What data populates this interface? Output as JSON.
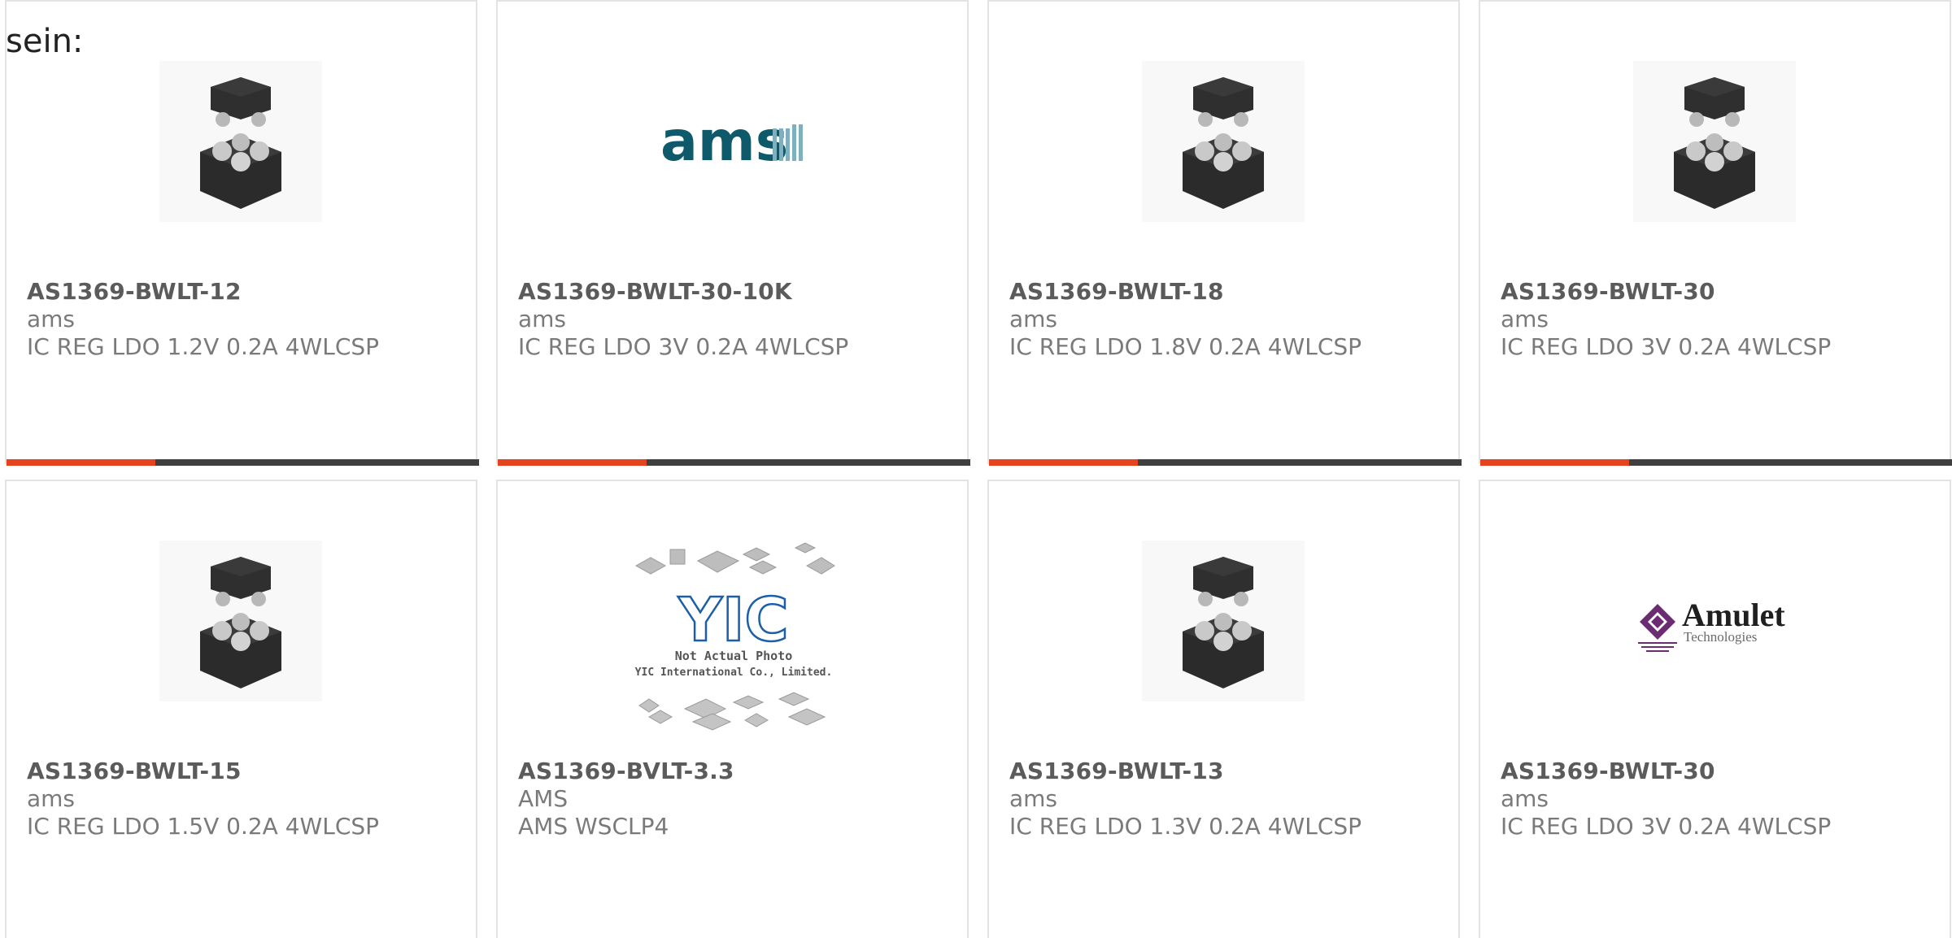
{
  "intro_text": "sein:",
  "colors": {
    "accent": "#e5431d",
    "bar": "#3f3f3f",
    "card_border": "#e3e3e3",
    "part_number": "#5b5b5b",
    "meta_text": "#7a7a7a",
    "ams_teal": "#0e5a6b",
    "amulet_purple": "#6b2c72"
  },
  "products": [
    {
      "part_number": "AS1369-BWLT-12",
      "manufacturer": "ams",
      "description": "IC REG LDO 1.2V 0.2A 4WLCSP",
      "image": "chip-package-image"
    },
    {
      "part_number": "AS1369-BWLT-30-10K",
      "manufacturer": "ams",
      "description": "IC REG LDO 3V 0.2A 4WLCSP",
      "image": "ams-logo"
    },
    {
      "part_number": "AS1369-BWLT-18",
      "manufacturer": "ams",
      "description": "IC REG LDO 1.8V 0.2A 4WLCSP",
      "image": "chip-package-image"
    },
    {
      "part_number": "AS1369-BWLT-30",
      "manufacturer": "ams",
      "description": "IC REG LDO 3V 0.2A 4WLCSP",
      "image": "chip-package-image"
    },
    {
      "part_number": "AS1369-BWLT-15",
      "manufacturer": "ams",
      "description": "IC REG LDO 1.5V 0.2A 4WLCSP",
      "image": "chip-package-image"
    },
    {
      "part_number": "AS1369-BVLT-3.3",
      "manufacturer": "AMS",
      "description": "AMS WSCLP4",
      "image": "yic-placeholder-image"
    },
    {
      "part_number": "AS1369-BWLT-13",
      "manufacturer": "ams",
      "description": "IC REG LDO 1.3V 0.2A 4WLCSP",
      "image": "chip-package-image"
    },
    {
      "part_number": "AS1369-BWLT-30",
      "manufacturer": "ams",
      "description": "IC REG LDO 3V 0.2A 4WLCSP",
      "image": "amulet-logo"
    }
  ],
  "logos": {
    "ams_logo_text": "ams",
    "yic_logo_text": "YIC",
    "yic_caption_line1": "Not Actual Photo",
    "yic_caption_line2": "YIC International Co., Limited.",
    "amulet_name": "Amulet",
    "amulet_sub": "Technologies"
  }
}
